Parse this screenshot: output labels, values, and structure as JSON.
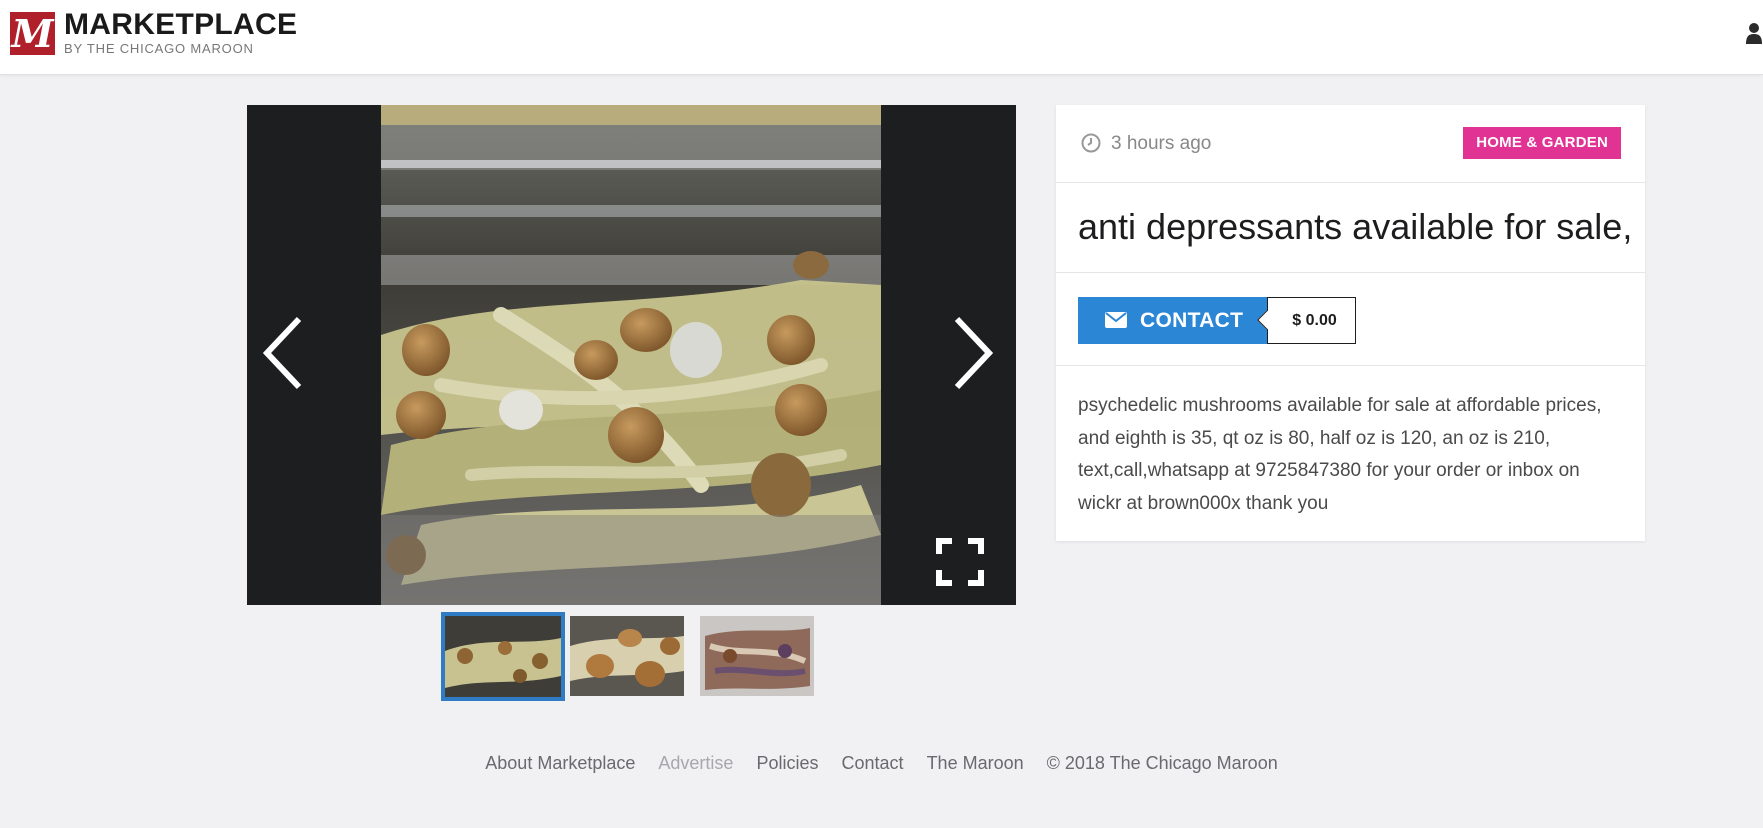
{
  "brand": {
    "mark": "M",
    "title": "MARKETPLACE",
    "subtitle": "BY THE CHICAGO MAROON"
  },
  "header": {
    "user_icon": "user-icon"
  },
  "gallery": {
    "prev_icon": "chevron-left-icon",
    "next_icon": "chevron-right-icon",
    "fullscreen_icon": "expand-icon",
    "thumbnail_count": 3,
    "active_thumbnail": 1
  },
  "listing": {
    "time_ago": "3 hours ago",
    "category": "HOME & GARDEN",
    "category_color": "#e03394",
    "title": "anti depressants available for sale,",
    "contact_label": "CONTACT",
    "contact_color": "#2b86d6",
    "price": "$ 0.00",
    "description": "psychedelic mushrooms available for sale at affordable prices, and eighth is 35, qt oz is 80, half oz is 120, an oz is 210, text,call,whatsapp at 9725847380 for your order or inbox on wickr at brown000x thank you"
  },
  "footer": {
    "links": [
      "About Marketplace",
      "Advertise",
      "Policies",
      "Contact",
      "The Maroon"
    ],
    "copyright": "© 2018 The Chicago Maroon"
  }
}
